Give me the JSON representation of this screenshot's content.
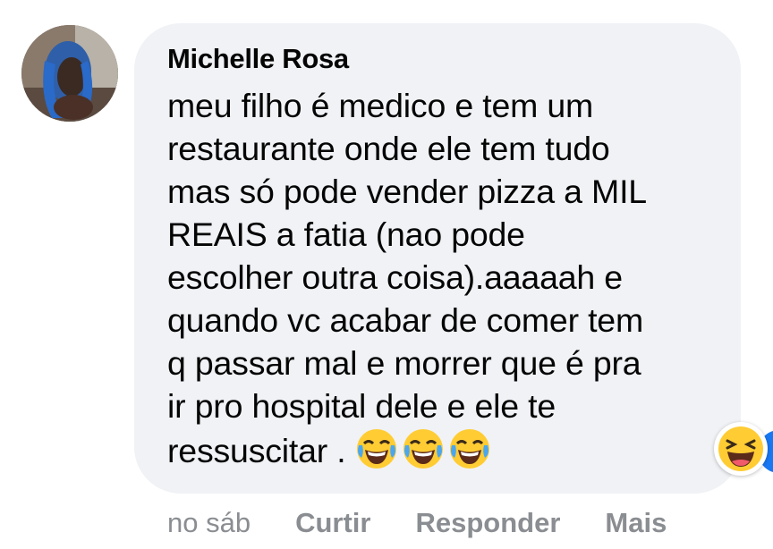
{
  "comment": {
    "author": "Michelle Rosa",
    "text": "meu filho é medico e tem um\nrestaurante onde ele tem tudo\nmas só pode vender pizza a MIL\nREAIS a fatia (nao pode\nescolher outra coisa).aaaaah e\nquando vc acabar de comer tem\nq passar mal e morrer que é pra\nir pro hospital dele e ele te\nressuscitar . ",
    "emojis": [
      "face-with-tears-of-joy",
      "face-with-tears-of-joy",
      "face-with-tears-of-joy"
    ],
    "reactions": [
      "haha",
      "like"
    ]
  },
  "actions": {
    "time": "no sáb",
    "like_label": "Curtir",
    "reply_label": "Responder",
    "more_label": "Mais"
  },
  "colors": {
    "bubble": "#f0f2f5",
    "meta_text": "#8a8d91",
    "like_blue": "#1877f2",
    "emoji_yellow": "#ffcc33"
  }
}
